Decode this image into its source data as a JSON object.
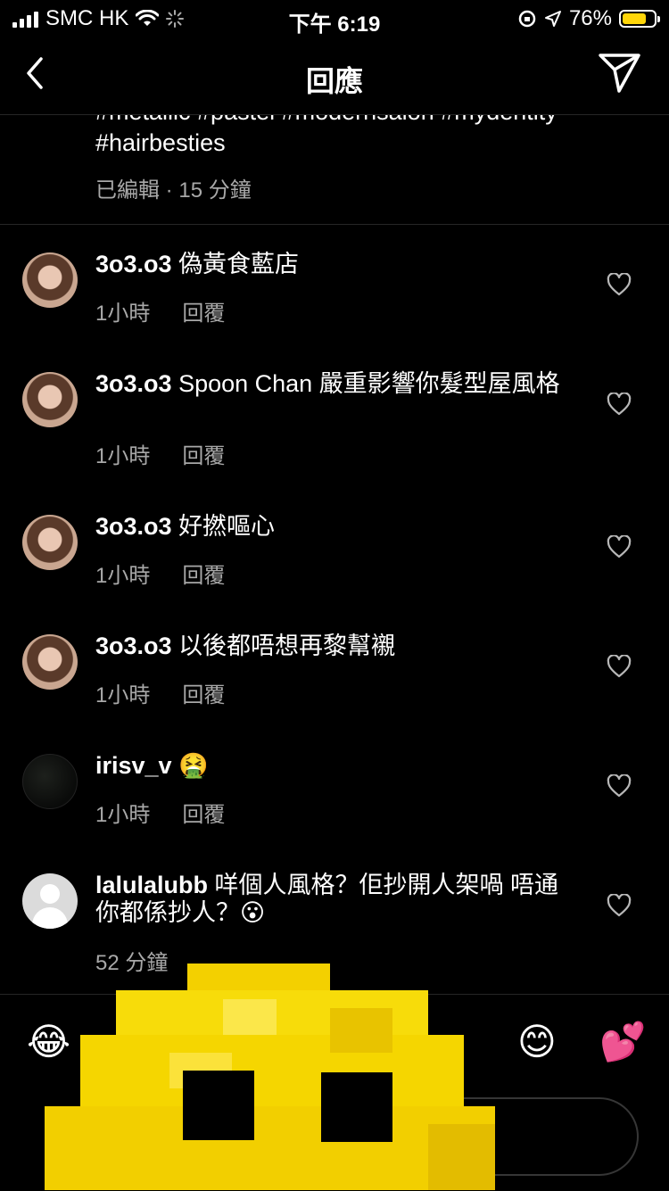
{
  "status_bar": {
    "carrier": "SMC HK",
    "time": "下午 6:19",
    "battery_percent": "76%",
    "battery_level": 0.76,
    "battery_color": "#ffd60a"
  },
  "header": {
    "title": "回應",
    "back_icon": "chevron-left-icon",
    "send_icon": "paper-plane-icon"
  },
  "caption": {
    "hashtags_line1": "#metallic #pastel #modernsalon #mydentity",
    "hashtags_line2": "#hairbesties",
    "edited": "已編輯",
    "time": "15 分鐘"
  },
  "comments": [
    {
      "user": "3o3.o3",
      "text": "偽黃食藍店",
      "time": "1小時",
      "reply": "回覆"
    },
    {
      "user": "3o3.o3",
      "text": "Spoon Chan 嚴重影響你髮型屋風格",
      "time": "1小時",
      "reply": "回覆"
    },
    {
      "user": "3o3.o3",
      "text": "好撚嘔心",
      "time": "1小時",
      "reply": "回覆"
    },
    {
      "user": "3o3.o3",
      "text": "以後都唔想再黎幫襯",
      "time": "1小時",
      "reply": "回覆"
    },
    {
      "user": "irisv_v",
      "text": "🤮",
      "time": "1小時",
      "reply": "回覆"
    },
    {
      "user": "lalulalubb",
      "text": "咩個人風格？佢抄開人架喎 唔通你都係抄人？😮",
      "time": "52 分鐘",
      "reply": ""
    }
  ],
  "emoji_bar": [
    "😂",
    "😊",
    "💕"
  ],
  "accent_colors": {
    "secondary_text": "#a8a8a8",
    "divider": "#262626",
    "overlay_yellow": "#f7dc0a"
  }
}
